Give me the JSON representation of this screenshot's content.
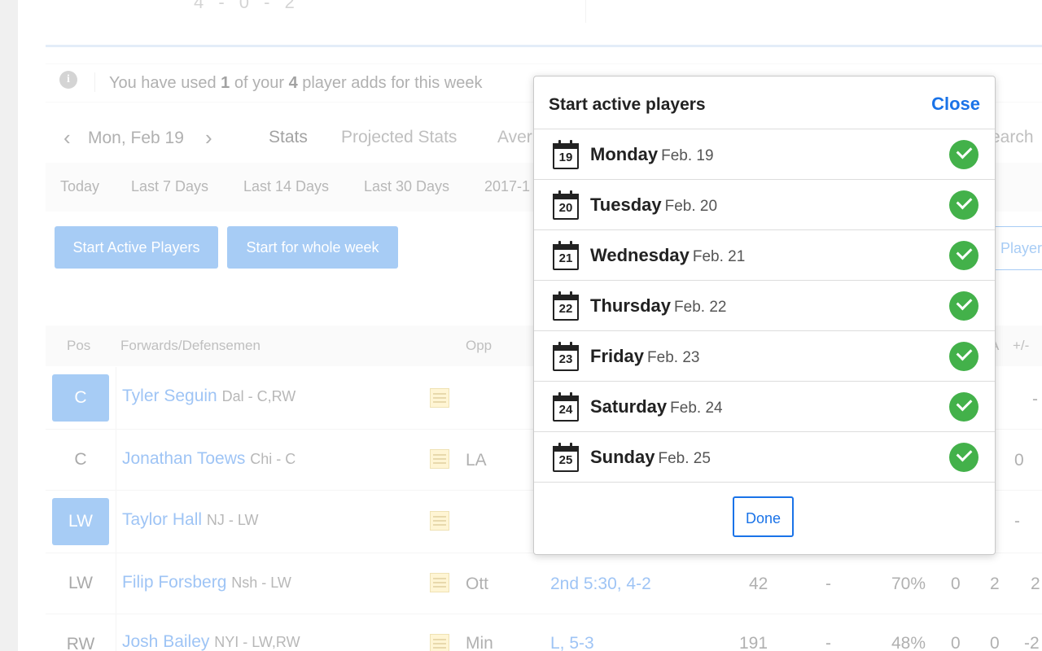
{
  "header": {
    "score_partial": "4 - 0 - 2"
  },
  "notice": {
    "pre": "You have used ",
    "used": "1",
    "mid": " of your ",
    "total": "4",
    "post": " player adds for this week"
  },
  "date_nav": {
    "prev": "‹",
    "date": "Mon, Feb 19",
    "next": "›"
  },
  "tabs": [
    "Stats",
    "Projected Stats",
    "Aver",
    "earch"
  ],
  "ranges": [
    "Today",
    "Last 7 Days",
    "Last 14 Days",
    "Last 30 Days",
    "2017-1"
  ],
  "buttons": {
    "start_active": "Start Active Players",
    "start_week": "Start for whole week",
    "player_partial": "Player"
  },
  "table": {
    "headers": {
      "pos": "Pos",
      "name": "Forwards/Defensemen",
      "opp": "Opp",
      "a": "A",
      "pm": "+/-"
    },
    "rows": [
      {
        "pos": "C",
        "starter": true,
        "name": "Tyler Seguin",
        "team": "Dal - C,RW",
        "opp": "",
        "status": "",
        "c1": "",
        "c2": "",
        "pct": "",
        "c4": "-",
        "c5": "",
        "c6": "-"
      },
      {
        "pos": "C",
        "starter": false,
        "name": "Jonathan Toews",
        "team": "Chi - C",
        "opp": "LA",
        "status": "",
        "c1": "",
        "c2": "",
        "pct": "",
        "c4": "0",
        "c5": "",
        "c6": "0"
      },
      {
        "pos": "LW",
        "starter": true,
        "name": "Taylor Hall",
        "team": "NJ - LW",
        "opp": "",
        "status": "",
        "c1": "",
        "c2": "",
        "pct": "",
        "c4": "-",
        "c5": "",
        "c6": "-"
      },
      {
        "pos": "LW",
        "starter": false,
        "name": "Filip Forsberg",
        "team": "Nsh - LW",
        "opp": "Ott",
        "status": "2nd 5:30, 4-2",
        "c1": "42",
        "c2": "-",
        "pct": "70%",
        "c4": "0",
        "c5": "2",
        "c6": "2"
      },
      {
        "pos": "RW",
        "starter": false,
        "name": "Josh Bailey",
        "team": "NYI - LW,RW",
        "opp": "Min",
        "status": "L, 5-3",
        "c1": "191",
        "c2": "-",
        "pct": "48%",
        "c4": "0",
        "c5": "0",
        "c6": "-2"
      }
    ]
  },
  "modal": {
    "title": "Start active players",
    "close": "Close",
    "done": "Done",
    "days": [
      {
        "num": "19",
        "name": "Monday",
        "date": "Feb. 19"
      },
      {
        "num": "20",
        "name": "Tuesday",
        "date": "Feb. 20"
      },
      {
        "num": "21",
        "name": "Wednesday",
        "date": "Feb. 21"
      },
      {
        "num": "22",
        "name": "Thursday",
        "date": "Feb. 22"
      },
      {
        "num": "23",
        "name": "Friday",
        "date": "Feb. 23"
      },
      {
        "num": "24",
        "name": "Saturday",
        "date": "Feb. 24"
      },
      {
        "num": "25",
        "name": "Sunday",
        "date": "Feb. 25"
      }
    ]
  },
  "colors": {
    "accent": "#1a73e8",
    "check": "#43b14a",
    "button": "#2e86e8"
  }
}
